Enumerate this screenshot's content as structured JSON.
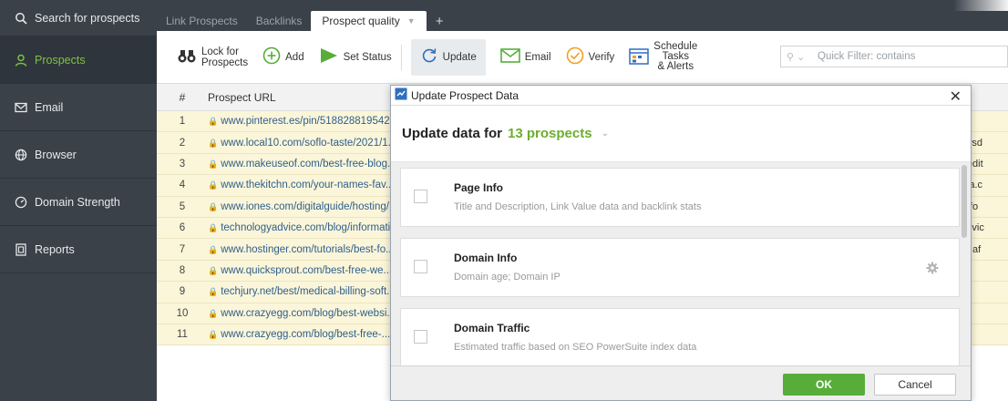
{
  "sidebar": {
    "search_label": "Search for prospects",
    "items": [
      {
        "label": "Prospects",
        "icon": "person-icon",
        "active": true
      },
      {
        "label": "Email",
        "icon": "mail-icon"
      },
      {
        "label": "Browser",
        "icon": "globe-icon"
      },
      {
        "label": "Domain Strength",
        "icon": "gauge-icon"
      },
      {
        "label": "Reports",
        "icon": "report-icon"
      }
    ]
  },
  "tabs": [
    {
      "label": "Link Prospects"
    },
    {
      "label": "Backlinks"
    },
    {
      "label": "Prospect quality",
      "active": true
    },
    {
      "label": "+"
    }
  ],
  "toolbar": {
    "lock_line1": "Lock for",
    "lock_line2": "Prospects",
    "add": "Add",
    "set_status": "Set Status",
    "update": "Update",
    "email": "Email",
    "verify": "Verify",
    "schedule_line1": "Schedule",
    "schedule_line2": "Tasks",
    "schedule_line3": "& Alerts",
    "filter_placeholder": "Quick Filter: contains"
  },
  "table": {
    "col_num": "#",
    "col_url": "Prospect URL",
    "rows": [
      {
        "num": "1",
        "url": "www.pinterest.es/pin/518828819542...",
        "right": ""
      },
      {
        "num": "2",
        "url": "www.local10.com/soflo-taste/2021/1...",
        "right": "n, newsd"
      },
      {
        "num": "3",
        "url": "www.makeuseof.com/best-free-blog...",
        "right": "com, edit"
      },
      {
        "num": "4",
        "url": "www.thekitchn.com/your-names-fav...",
        "right": "smedia.c"
      },
      {
        "num": "5",
        "url": "www.iones.com/digitalguide/hosting/...",
        "right": "om, info"
      },
      {
        "num": "6",
        "url": "technologyadvice.com/blog/informati...",
        "right": "logyadvic"
      },
      {
        "num": "7",
        "url": "www.hostinger.com/tutorials/best-fo...",
        "right": "r.com, af"
      },
      {
        "num": "8",
        "url": "www.quicksprout.com/best-free-we...",
        "right": ""
      },
      {
        "num": "9",
        "url": "techjury.net/best/medical-billing-soft...",
        "right": ""
      },
      {
        "num": "10",
        "url": "www.crazyegg.com/blog/best-websi...",
        "right": ""
      },
      {
        "num": "11",
        "url": "www.crazyegg.com/blog/best-free-...",
        "right": ""
      }
    ]
  },
  "dialog": {
    "title": "Update Prospect Data",
    "header_prefix": "Update data for",
    "header_count": "13 prospects",
    "options": [
      {
        "title": "Page Info",
        "desc": "Title and Description, Link Value data and backlink stats",
        "gear": false
      },
      {
        "title": "Domain Info",
        "desc": "Domain age; Domain IP",
        "gear": true
      },
      {
        "title": "Domain Traffic",
        "desc": "Estimated traffic based on SEO PowerSuite index data",
        "gear": false
      }
    ],
    "ok": "OK",
    "cancel": "Cancel"
  },
  "colors": {
    "sidebar_bg": "#3a4149",
    "accent_green": "#6cae2d",
    "row_highlight": "#fbf6d9",
    "ok_button": "#58ad3a"
  }
}
